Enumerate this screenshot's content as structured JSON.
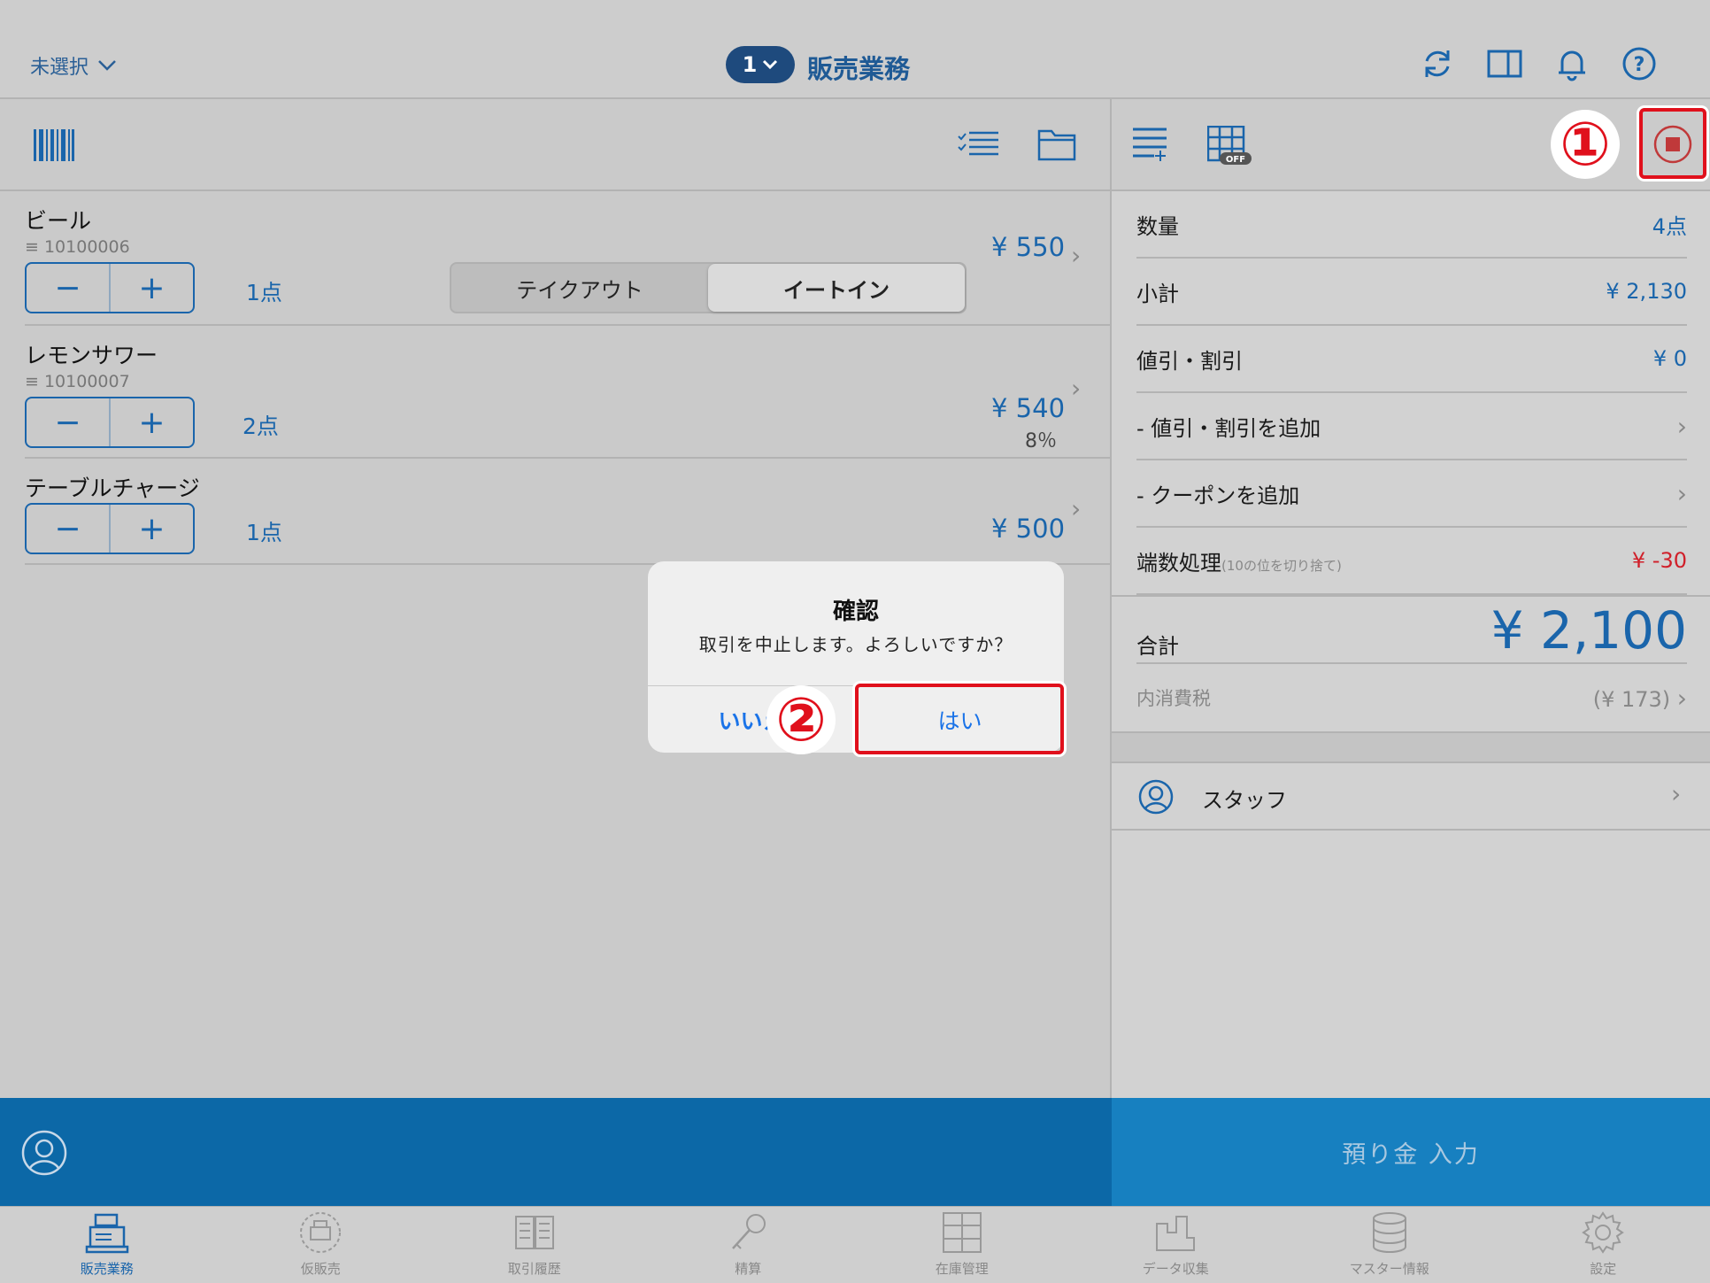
{
  "header": {
    "selector_label": "未選択",
    "register_number": "1",
    "title": "販売業務"
  },
  "items": [
    {
      "name": "ビール",
      "code": "10100006",
      "qty": "1点",
      "price": "¥ 550",
      "tax": ""
    },
    {
      "name": "レモンサワー",
      "code": "10100007",
      "qty": "2点",
      "price": "¥ 540",
      "tax": "8％"
    },
    {
      "name": "テーブルチャージ",
      "code": "",
      "qty": "1点",
      "price": "¥ 500",
      "tax": ""
    }
  ],
  "dining_toggle": {
    "options": [
      "テイクアウト",
      "イートイン"
    ],
    "selected": "イートイン"
  },
  "summary": {
    "qty_label": "数量",
    "qty_value": "4点",
    "subtotal_label": "小計",
    "subtotal_value": "¥ 2,130",
    "discount_label": "値引・割引",
    "discount_value": "¥ 0",
    "add_discount_label": "- 値引・割引を追加",
    "add_coupon_label": "- クーポンを追加",
    "rounding_label": "端数処理",
    "rounding_note": "(10の位を切り捨て)",
    "rounding_value": "¥ -30",
    "total_label": "合計",
    "total_value": "¥ 2,100",
    "tax_label": "内消費税",
    "tax_value": "(¥ 173)",
    "staff_label": "スタッフ"
  },
  "toolbar_right": {
    "grid_badge": "OFF"
  },
  "deposit_button": "預り金 入力",
  "dialog": {
    "title": "確認",
    "message": "取引を中止します。よろしいですか？",
    "no_label": "いいえ",
    "yes_label": "はい"
  },
  "annotations": {
    "marker1": "①",
    "marker2": "②"
  },
  "tabs": [
    {
      "label": "販売業務",
      "icon": "register-icon",
      "active": true
    },
    {
      "label": "仮販売",
      "icon": "temp-sale-icon",
      "active": false
    },
    {
      "label": "取引履歴",
      "icon": "history-icon",
      "active": false
    },
    {
      "label": "精算",
      "icon": "key-icon",
      "active": false
    },
    {
      "label": "在庫管理",
      "icon": "inventory-icon",
      "active": false
    },
    {
      "label": "データ収集",
      "icon": "data-icon",
      "active": false
    },
    {
      "label": "マスター情報",
      "icon": "database-icon",
      "active": false
    },
    {
      "label": "設定",
      "icon": "gear-icon",
      "active": false
    }
  ],
  "colors": {
    "accent": "#1a65ab",
    "annotation": "#e0101c",
    "bottom_bar": "#0c68a7"
  }
}
